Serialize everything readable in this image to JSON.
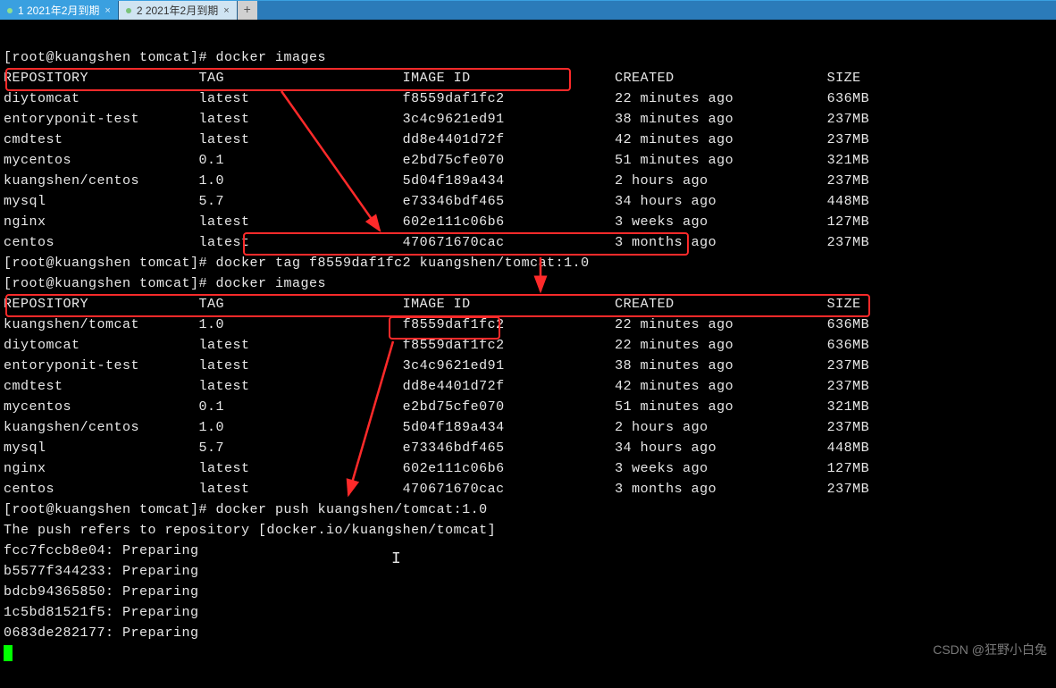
{
  "tabs": {
    "t1": "1 2021年2月到期",
    "t2": "2 2021年2月到期",
    "add": "+"
  },
  "prompt": "[root@kuangshen tomcat]#",
  "cmd1": "docker images",
  "cmd2": "docker tag f8559daf1fc2 kuangshen/tomcat:1.0",
  "cmd3": "docker images",
  "cmd4": "docker push kuangshen/tomcat:1.0",
  "push_refers": "The push refers to repository [docker.io/kuangshen/tomcat]",
  "hdr": {
    "repo": "REPOSITORY",
    "tag": "TAG",
    "id": "IMAGE ID",
    "created": "CREATED",
    "size": "SIZE"
  },
  "img1": [
    {
      "repo": "diytomcat",
      "tag": "latest",
      "id": "f8559daf1fc2",
      "created": "22 minutes ago",
      "size": "636MB"
    },
    {
      "repo": "entoryponit-test",
      "tag": "latest",
      "id": "3c4c9621ed91",
      "created": "38 minutes ago",
      "size": "237MB"
    },
    {
      "repo": "cmdtest",
      "tag": "latest",
      "id": "dd8e4401d72f",
      "created": "42 minutes ago",
      "size": "237MB"
    },
    {
      "repo": "mycentos",
      "tag": "0.1",
      "id": "e2bd75cfe070",
      "created": "51 minutes ago",
      "size": "321MB"
    },
    {
      "repo": "kuangshen/centos",
      "tag": "1.0",
      "id": "5d04f189a434",
      "created": "2 hours ago",
      "size": "237MB"
    },
    {
      "repo": "mysql",
      "tag": "5.7",
      "id": "e73346bdf465",
      "created": "34 hours ago",
      "size": "448MB"
    },
    {
      "repo": "nginx",
      "tag": "latest",
      "id": "602e111c06b6",
      "created": "3 weeks ago",
      "size": "127MB"
    },
    {
      "repo": "centos",
      "tag": "latest",
      "id": "470671670cac",
      "created": "3 months ago",
      "size": "237MB"
    }
  ],
  "img2": [
    {
      "repo": "kuangshen/tomcat",
      "tag": "1.0",
      "id": "f8559daf1fc2",
      "created": "22 minutes ago",
      "size": "636MB"
    },
    {
      "repo": "diytomcat",
      "tag": "latest",
      "id": "f8559daf1fc2",
      "created": "22 minutes ago",
      "size": "636MB"
    },
    {
      "repo": "entoryponit-test",
      "tag": "latest",
      "id": "3c4c9621ed91",
      "created": "38 minutes ago",
      "size": "237MB"
    },
    {
      "repo": "cmdtest",
      "tag": "latest",
      "id": "dd8e4401d72f",
      "created": "42 minutes ago",
      "size": "237MB"
    },
    {
      "repo": "mycentos",
      "tag": "0.1",
      "id": "e2bd75cfe070",
      "created": "51 minutes ago",
      "size": "321MB"
    },
    {
      "repo": "kuangshen/centos",
      "tag": "1.0",
      "id": "5d04f189a434",
      "created": "2 hours ago",
      "size": "237MB"
    },
    {
      "repo": "mysql",
      "tag": "5.7",
      "id": "e73346bdf465",
      "created": "34 hours ago",
      "size": "448MB"
    },
    {
      "repo": "nginx",
      "tag": "latest",
      "id": "602e111c06b6",
      "created": "3 weeks ago",
      "size": "127MB"
    },
    {
      "repo": "centos",
      "tag": "latest",
      "id": "470671670cac",
      "created": "3 months ago",
      "size": "237MB"
    }
  ],
  "layers": [
    {
      "hash": "fcc7fccb8e04",
      "state": "Preparing"
    },
    {
      "hash": "b5577f344233",
      "state": "Preparing"
    },
    {
      "hash": "bdcb94365850",
      "state": "Preparing"
    },
    {
      "hash": "1c5bd81521f5",
      "state": "Preparing"
    },
    {
      "hash": "0683de282177",
      "state": "Preparing"
    }
  ],
  "watermark": "CSDN @狂野小白兔"
}
